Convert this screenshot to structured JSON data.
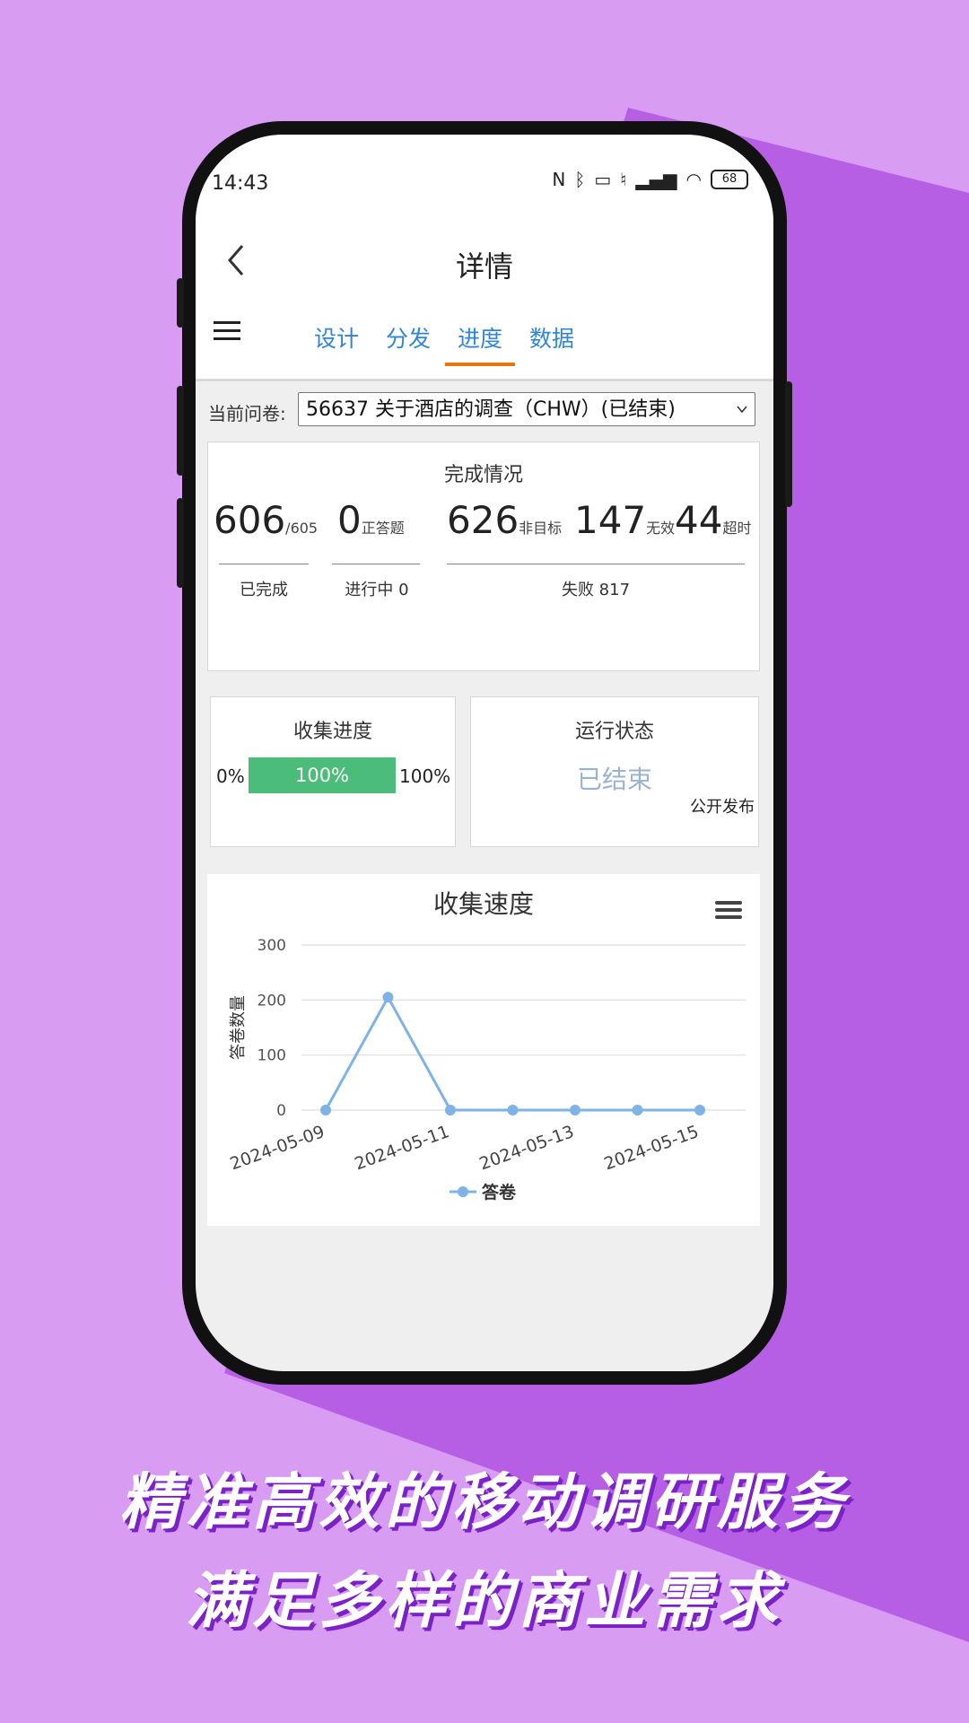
{
  "colors": {
    "background": "#d99cf3",
    "accent_purple": "#b65ee4",
    "tab_blue": "#2f86d6",
    "tab_underline": "#e4760c",
    "progress_green": "#4bbc7a",
    "line_blue": "#7eb3e6"
  },
  "status_bar": {
    "time": "14:43",
    "battery": "68",
    "icons": [
      "nfc-icon",
      "bluetooth-icon",
      "vibrate-icon",
      "mute-icon",
      "signal-icon",
      "wifi-icon",
      "battery-icon"
    ]
  },
  "header": {
    "title": "详情"
  },
  "tabs": [
    {
      "label": "设计"
    },
    {
      "label": "分发"
    },
    {
      "label": "进度",
      "active": true
    },
    {
      "label": "数据"
    }
  ],
  "survey": {
    "label": "当前问卷:",
    "selected": "56637 关于酒店的调查（CHW）(已结束)"
  },
  "completion": {
    "title": "完成情况",
    "completed": "606",
    "completed_total": "/605",
    "completed_caption": "已完成",
    "answering": "0",
    "answering_unit": "正答题",
    "in_progress_caption": "进行中 0",
    "non_target": "626",
    "non_target_unit": "非目标",
    "invalid": "147",
    "invalid_unit": "无效",
    "timeout": "44",
    "timeout_unit": "超时",
    "failed_caption": "失败 817"
  },
  "progress": {
    "title": "收集进度",
    "min_label": "0%",
    "value_label": "100%",
    "max_label": "100%",
    "percent": 100
  },
  "run_status": {
    "title": "运行状态",
    "status": "已结束",
    "mode": "公开发布"
  },
  "chart_data": {
    "type": "line",
    "title": "收集速度",
    "ylabel": "答卷数量",
    "ylim": [
      0,
      300
    ],
    "yticks": [
      "0",
      "100",
      "200",
      "300"
    ],
    "x": [
      "2024-05-09",
      "2024-05-10",
      "2024-05-11",
      "2024-05-12",
      "2024-05-13",
      "2024-05-14",
      "2024-05-15"
    ],
    "xtick_labels": [
      "2024-05-09",
      "2024-05-11",
      "2024-05-13",
      "2024-05-15"
    ],
    "series": [
      {
        "name": "答卷",
        "values": [
          0,
          205,
          0,
          0,
          0,
          0,
          0
        ]
      }
    ],
    "grid": true,
    "legend": "bottom"
  },
  "slogan": {
    "line1": "精准高效的移动调研服务",
    "line2": "满足多样的商业需求"
  }
}
